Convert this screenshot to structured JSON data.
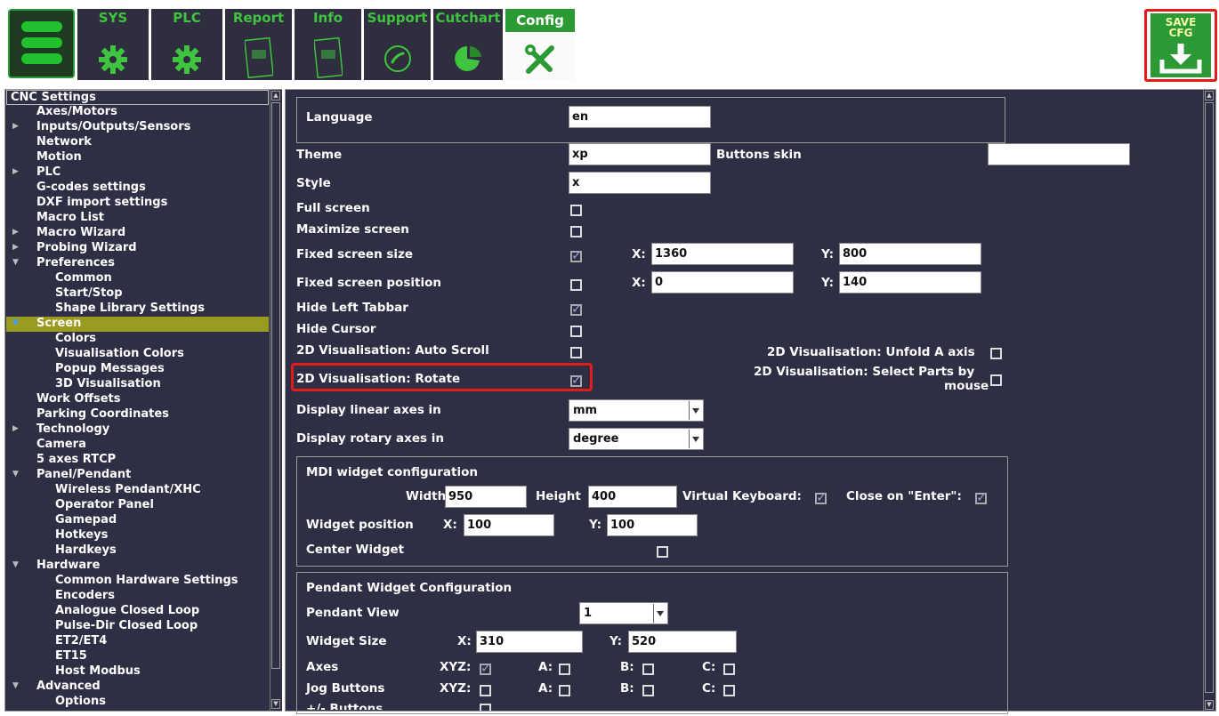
{
  "toolbar": {
    "tabs": [
      {
        "label": "SYS"
      },
      {
        "label": "PLC"
      },
      {
        "label": "Report"
      },
      {
        "label": "Info"
      },
      {
        "label": "Support"
      },
      {
        "label": "Cutchart"
      },
      {
        "label": "Config"
      }
    ],
    "save_line1": "SAVE",
    "save_line2": "CFG"
  },
  "sidebar": {
    "items": [
      {
        "label": "CNC Settings"
      },
      {
        "label": "Axes/Motors"
      },
      {
        "label": "Inputs/Outputs/Sensors"
      },
      {
        "label": "Network"
      },
      {
        "label": "Motion"
      },
      {
        "label": "PLC"
      },
      {
        "label": "G-codes settings"
      },
      {
        "label": "DXF import settings"
      },
      {
        "label": "Macro List"
      },
      {
        "label": "Macro Wizard"
      },
      {
        "label": "Probing Wizard"
      },
      {
        "label": "Preferences"
      },
      {
        "label": "Common"
      },
      {
        "label": "Start/Stop"
      },
      {
        "label": "Shape Library Settings"
      },
      {
        "label": "Screen"
      },
      {
        "label": "Colors"
      },
      {
        "label": "Visualisation Colors"
      },
      {
        "label": "Popup Messages"
      },
      {
        "label": "3D Visualisation"
      },
      {
        "label": "Work Offsets"
      },
      {
        "label": "Parking Coordinates"
      },
      {
        "label": "Technology"
      },
      {
        "label": "Camera"
      },
      {
        "label": "5 axes RTCP"
      },
      {
        "label": "Panel/Pendant"
      },
      {
        "label": "Wireless Pendant/XHC"
      },
      {
        "label": "Operator Panel"
      },
      {
        "label": "Gamepad"
      },
      {
        "label": "Hotkeys"
      },
      {
        "label": "Hardkeys"
      },
      {
        "label": "Hardware"
      },
      {
        "label": "Common Hardware Settings"
      },
      {
        "label": "Encoders"
      },
      {
        "label": "Analogue Closed Loop"
      },
      {
        "label": "Pulse-Dir Closed Loop"
      },
      {
        "label": "ET2/ET4"
      },
      {
        "label": "ET15"
      },
      {
        "label": "Host Modbus"
      },
      {
        "label": "Advanced"
      },
      {
        "label": "Options"
      }
    ]
  },
  "settings": {
    "language_label": "Language",
    "language_value": "en",
    "theme_label": "Theme",
    "theme_value": "xp",
    "buttons_skin_label": "Buttons skin",
    "buttons_skin_value": "",
    "style_label": "Style",
    "style_value": "x",
    "full_screen_label": "Full screen",
    "maximize_screen_label": "Maximize screen",
    "fixed_size_label": "Fixed screen size",
    "fixed_size_x_label": "X:",
    "fixed_size_x": "1360",
    "fixed_size_y_label": "Y:",
    "fixed_size_y": "800",
    "fixed_pos_label": "Fixed screen position",
    "fixed_pos_x_label": "X:",
    "fixed_pos_x": "0",
    "fixed_pos_y_label": "Y:",
    "fixed_pos_y": "140",
    "hide_left_tabbar_label": "Hide Left Tabbar",
    "hide_cursor_label": "Hide Cursor",
    "auto_scroll_label": "2D Visualisation: Auto Scroll",
    "unfold_a_label": "2D Visualisation: Unfold A axis",
    "rotate_label": "2D Visualisation: Rotate",
    "select_parts_line1": "2D Visualisation: Select Parts by",
    "select_parts_line2": "mouse",
    "linear_axes_label": "Display linear axes in",
    "linear_axes_value": "mm",
    "rotary_axes_label": "Display rotary axes in",
    "rotary_axes_value": "degree"
  },
  "mdi": {
    "title": "MDI widget configuration",
    "width_label": "Width",
    "width_value": "950",
    "height_label": "Height",
    "height_value": "400",
    "virtual_kb_label": "Virtual Keyboard:",
    "close_enter_label": "Close on \"Enter\":",
    "pos_label": "Widget position",
    "pos_x_label": "X:",
    "pos_x": "100",
    "pos_y_label": "Y:",
    "pos_y": "100",
    "center_label": "Center Widget"
  },
  "pendant": {
    "title": "Pendant Widget Configuration",
    "view_label": "Pendant View",
    "view_value": "1",
    "size_label": "Widget Size",
    "size_x_label": "X:",
    "size_x": "310",
    "size_y_label": "Y:",
    "size_y": "520",
    "axes_label": "Axes",
    "jog_label": "Jog Buttons",
    "pm_label": "+/- Buttons",
    "xyz_label": "XYZ:",
    "a_label": "A:",
    "b_label": "B:",
    "c_label": "C:"
  },
  "colors": {
    "panel_bg": "#2e2e44",
    "accent_green": "#2c9a34",
    "highlight_red": "#e31b1b",
    "selected_item": "#9a9a20"
  }
}
